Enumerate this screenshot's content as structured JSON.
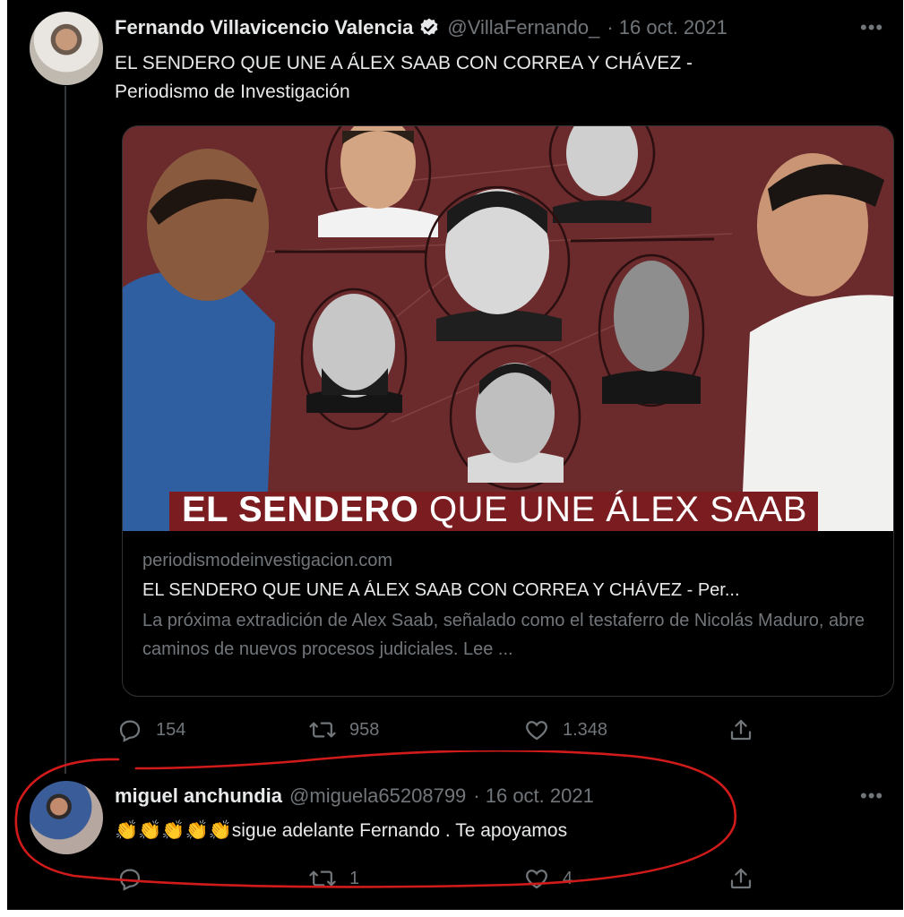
{
  "tweet": {
    "author_name": "Fernando Villavicencio Valencia",
    "handle": "@VillaFernando_",
    "date": "· 16 oct. 2021",
    "text_line1": "EL SENDERO QUE UNE A ÁLEX SAAB CON CORREA Y CHÁVEZ -",
    "text_line2": "Periodismo de Investigación",
    "more": "•••",
    "card": {
      "banner_bold": "EL SENDERO",
      "banner_rest": " QUE UNE ÁLEX SAAB",
      "domain": "periodismodeinvestigacion.com",
      "title": "EL SENDERO QUE UNE A ÁLEX SAAB CON CORREA Y CHÁVEZ - Per...",
      "description": "La próxima extradición de Alex Saab, señalado como el testaferro de Nicolás Maduro, abre caminos de nuevos procesos judiciales. Lee ..."
    },
    "stats": {
      "replies": "154",
      "retweets": "958",
      "likes": "1.348"
    }
  },
  "reply": {
    "author_name": "miguel anchundia",
    "handle": "@miguela65208799",
    "date": "· 16 oct. 2021",
    "text": "👏👏👏👏👏sigue adelante Fernando . Te apoyamos",
    "more": "•••",
    "stats": {
      "replies": "",
      "retweets": "1",
      "likes": "4"
    }
  },
  "colors": {
    "background": "#000000",
    "primary_text": "#e7e9ea",
    "secondary_text": "#71767b",
    "annotation_red": "#d11a1a",
    "verified": "#e7e9ea"
  },
  "icons": [
    "reply-icon",
    "retweet-icon",
    "like-icon",
    "share-icon",
    "verified-icon",
    "more-icon"
  ]
}
